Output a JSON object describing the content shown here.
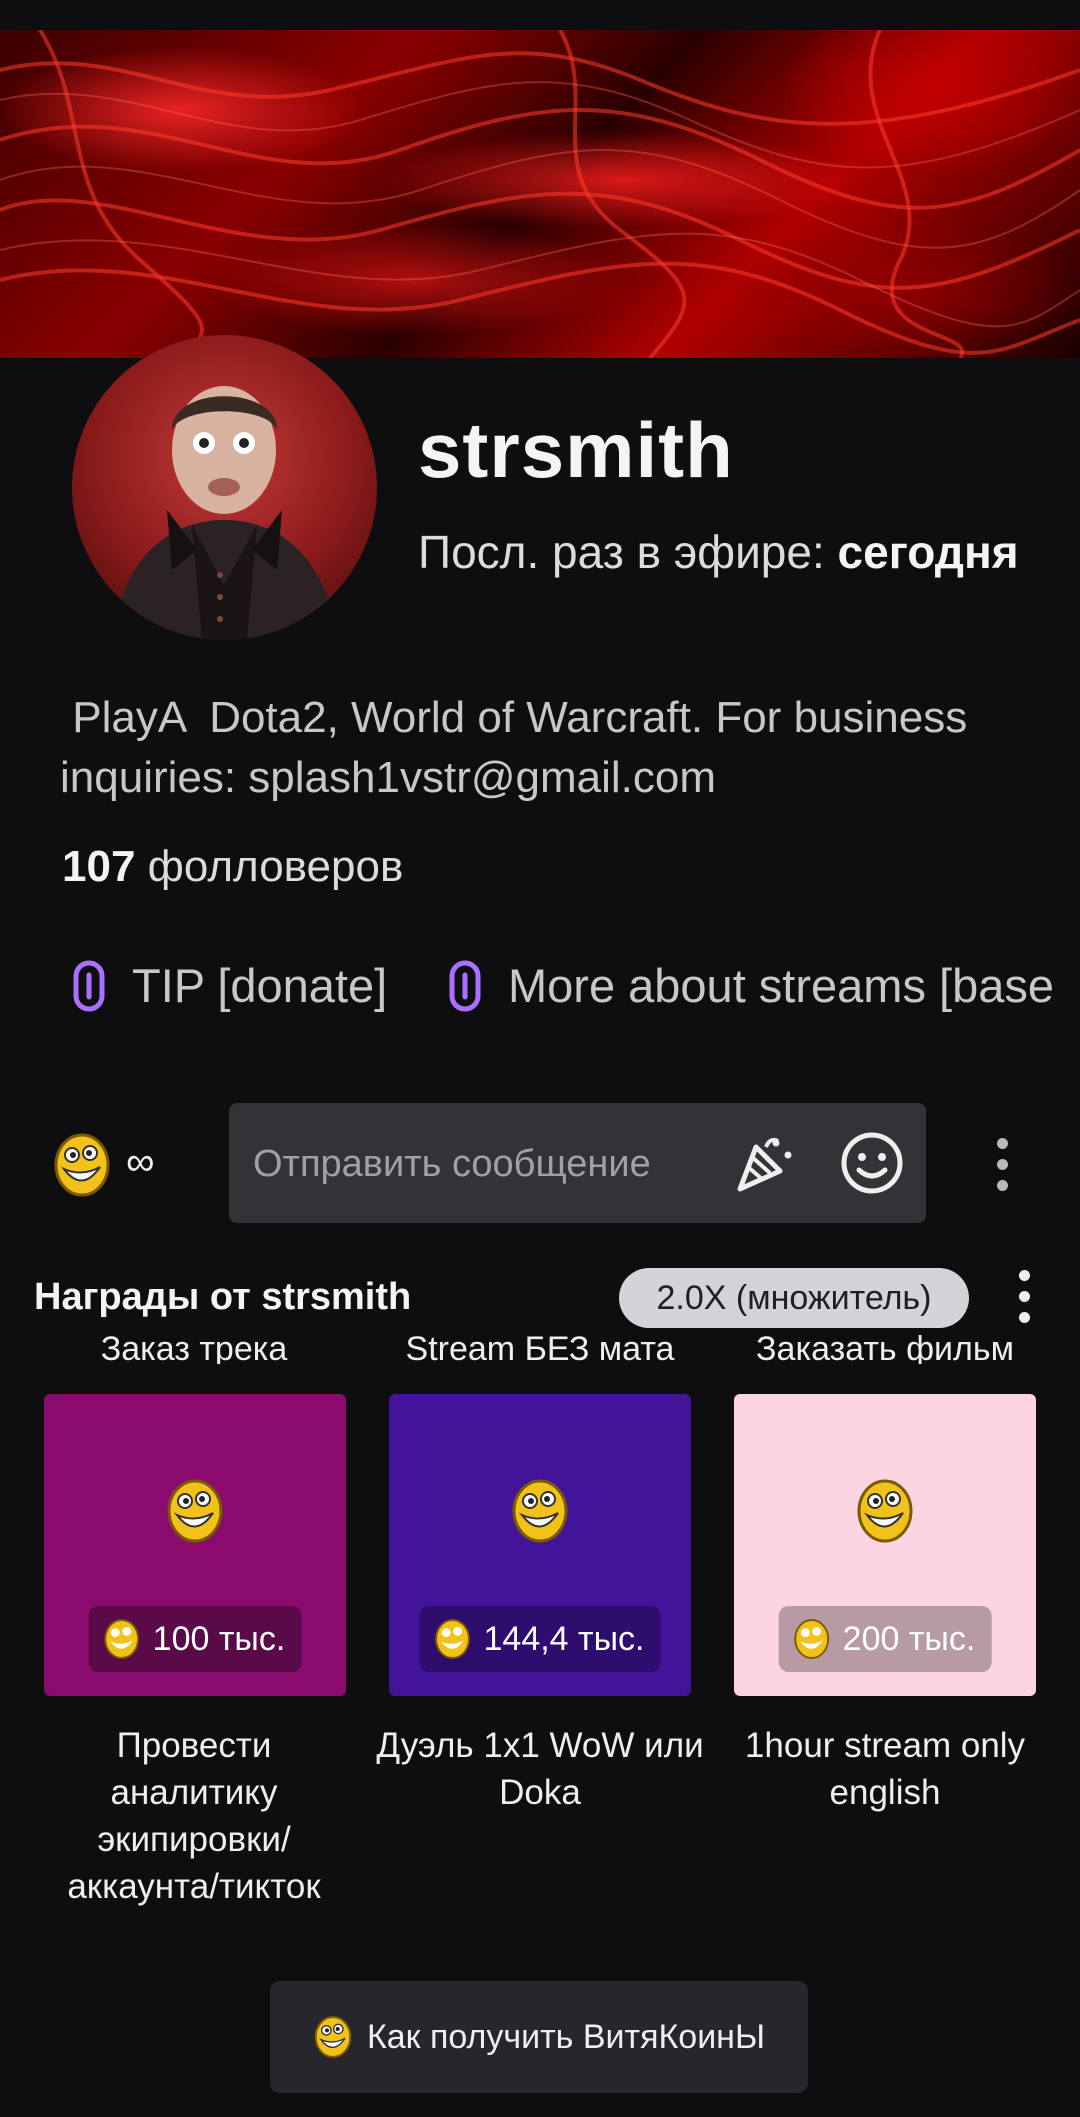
{
  "channel": {
    "name": "strsmith",
    "last_live_label": "Посл. раз в эфире: ",
    "last_live_value": "сегодня",
    "bio_line1": " PlayA  Dota2, World of Warcraft. For business",
    "bio_line2": "inquiries: splash1vstr@gmail.com",
    "followers_count": "107",
    "followers_label": " фолловеров"
  },
  "links": [
    {
      "label": "TIP [donate]",
      "icon": "link-icon"
    },
    {
      "label": "More about streams [base",
      "icon": "link-icon"
    }
  ],
  "chat": {
    "points_value": "∞",
    "placeholder": "Отправить сообщение",
    "icons": [
      "party-popper-icon",
      "smiley-icon",
      "more-vertical-icon"
    ]
  },
  "rewards": {
    "title": "Награды от strsmith",
    "multiplier": "2.0X (множитель)",
    "cut_labels": [
      "Заказ трека",
      "Stream БЕЗ мата",
      "Заказать фильм"
    ],
    "items": [
      {
        "name": "Провести аналитику экипировки/ аккаунта/тикток",
        "price": "100 тыс.",
        "color": "#8b0a6e",
        "pill": "#5a0a48"
      },
      {
        "name": "Дуэль 1x1 WoW или Doka",
        "price": "144,4 тыс.",
        "color": "#43139a",
        "pill": "#2e0d6e"
      },
      {
        "name": "1hour stream only english",
        "price": "200 тыс.",
        "color": "#fdd4e2",
        "pill": "#b89aa5"
      }
    ],
    "how_to_label": "Как получить ВитяКоинЫ"
  },
  "colors": {
    "background": "#0e0e10",
    "accent": "#a970ff",
    "input": "#323237"
  }
}
